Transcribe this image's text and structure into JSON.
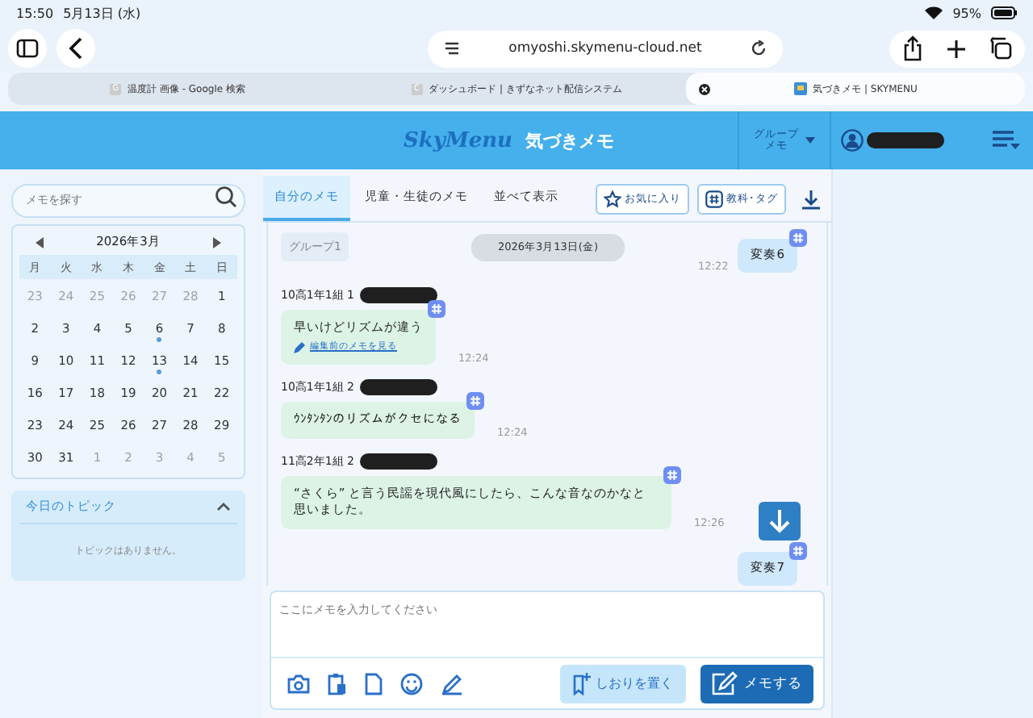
{
  "status_bar": {
    "time": "15:50",
    "date": "5月13日 (水)",
    "battery": "95%"
  },
  "browser": {
    "url": "omyoshi.skymenu-cloud.net",
    "tabs": [
      {
        "title": "温度計 画像 - Google 検索",
        "favicon": "G",
        "selected": false
      },
      {
        "title": "ダッシュボード | きずなネット配信システム",
        "favicon": "C",
        "selected": false
      },
      {
        "title": "気づきメモ | SKYMENU",
        "selected": true
      }
    ]
  },
  "header": {
    "logo": "SkyMenu",
    "title": "気づきメモ",
    "group_menu": [
      "グループ",
      "メモ"
    ]
  },
  "sidebar": {
    "search": {
      "placeholder": "メモを探す"
    },
    "calendar": {
      "month": "2026年3月",
      "weekdays": [
        "月",
        "火",
        "水",
        "木",
        "金",
        "土",
        "日"
      ],
      "weeks": [
        [
          {
            "d": "23",
            "muted": true,
            "dot": false
          },
          {
            "d": "24",
            "muted": true,
            "dot": false
          },
          {
            "d": "25",
            "muted": true,
            "dot": false
          },
          {
            "d": "26",
            "muted": true,
            "dot": false
          },
          {
            "d": "27",
            "muted": true,
            "dot": false
          },
          {
            "d": "28",
            "muted": true,
            "dot": false
          },
          {
            "d": "1",
            "muted": false,
            "dot": false
          }
        ],
        [
          {
            "d": "2",
            "muted": false,
            "dot": false
          },
          {
            "d": "3",
            "muted": false,
            "dot": false
          },
          {
            "d": "4",
            "muted": false,
            "dot": false
          },
          {
            "d": "5",
            "muted": false,
            "dot": false
          },
          {
            "d": "6",
            "muted": false,
            "dot": true
          },
          {
            "d": "7",
            "muted": false,
            "dot": false
          },
          {
            "d": "8",
            "muted": false,
            "dot": false
          }
        ],
        [
          {
            "d": "9",
            "muted": false,
            "dot": false
          },
          {
            "d": "10",
            "muted": false,
            "dot": false
          },
          {
            "d": "11",
            "muted": false,
            "dot": false
          },
          {
            "d": "12",
            "muted": false,
            "dot": false
          },
          {
            "d": "13",
            "muted": false,
            "dot": true
          },
          {
            "d": "14",
            "muted": false,
            "dot": false
          },
          {
            "d": "15",
            "muted": false,
            "dot": false
          }
        ],
        [
          {
            "d": "16",
            "muted": false,
            "dot": false
          },
          {
            "d": "17",
            "muted": false,
            "dot": false
          },
          {
            "d": "18",
            "muted": false,
            "dot": false
          },
          {
            "d": "19",
            "muted": false,
            "dot": false
          },
          {
            "d": "20",
            "muted": false,
            "dot": false
          },
          {
            "d": "21",
            "muted": false,
            "dot": false
          },
          {
            "d": "22",
            "muted": false,
            "dot": false
          }
        ],
        [
          {
            "d": "23",
            "muted": false,
            "dot": false
          },
          {
            "d": "24",
            "muted": false,
            "dot": false
          },
          {
            "d": "25",
            "muted": false,
            "dot": false
          },
          {
            "d": "26",
            "muted": false,
            "dot": false
          },
          {
            "d": "27",
            "muted": false,
            "dot": false
          },
          {
            "d": "28",
            "muted": false,
            "dot": false
          },
          {
            "d": "29",
            "muted": false,
            "dot": false
          }
        ],
        [
          {
            "d": "30",
            "muted": false,
            "dot": false
          },
          {
            "d": "31",
            "muted": false,
            "dot": false
          },
          {
            "d": "1",
            "muted": true,
            "dot": false
          },
          {
            "d": "2",
            "muted": true,
            "dot": false
          },
          {
            "d": "3",
            "muted": true,
            "dot": false
          },
          {
            "d": "4",
            "muted": true,
            "dot": false
          },
          {
            "d": "5",
            "muted": true,
            "dot": false
          }
        ]
      ]
    },
    "topic": {
      "title": "今日のトピック",
      "expanded": true,
      "empty_text": "トピックはありません。"
    }
  },
  "memo_tabs": [
    {
      "label": "自分のメモ",
      "selected": true
    },
    {
      "label": "児童・生徒のメモ",
      "selected": false
    },
    {
      "label": "並べて表示",
      "selected": false
    }
  ],
  "toolbar_buttons": [
    "お気に入り",
    "教科･タグ"
  ],
  "chat": {
    "group_label": "グループ1",
    "date": "2026年3月13日(金)",
    "messages": [
      {
        "kind": "own",
        "text": "変奏6",
        "time": "12:22"
      },
      {
        "kind": "other",
        "author": "10高1年1組 1",
        "text": "早いけどリズムが違う",
        "link": "編集前のメモを見る",
        "time": "12:24"
      },
      {
        "kind": "other",
        "author": "10高1年1組 2",
        "text": "ｳﾝﾀﾝﾀﾝのリズムがクセになる",
        "time": "12:24"
      },
      {
        "kind": "other",
        "author": "11高2年1組 2",
        "text": "“さくら” と言う民謡を現代風にしたら、こんな音なのかなと思いました。",
        "time": "12:26"
      },
      {
        "kind": "own",
        "text": "変奏7"
      }
    ]
  },
  "composer": {
    "placeholder": "ここにメモを入力してください",
    "bookmark_button": "しおりを置く",
    "submit_button": "メモする"
  }
}
